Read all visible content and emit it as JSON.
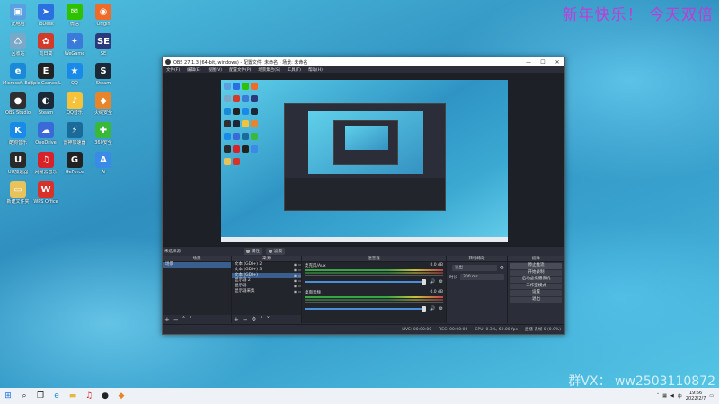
{
  "desktop": {
    "banner": "新年快乐！ 今天双倍",
    "watermark": "群VX：  ww2503110872",
    "icons": [
      {
        "label": "此电脑",
        "color": "#5aa0e0",
        "glyph": "▣"
      },
      {
        "label": "ToDesk",
        "color": "#2b6fe0",
        "glyph": "➤"
      },
      {
        "label": "微信",
        "color": "#2dc100",
        "glyph": "✉"
      },
      {
        "label": "Origin",
        "color": "#f06a28",
        "glyph": "◉"
      },
      {
        "label": "回收站",
        "color": "#7aa8c8",
        "glyph": "♺"
      },
      {
        "label": "向日葵",
        "color": "#d33a2a",
        "glyph": "✿"
      },
      {
        "label": "WeGame",
        "color": "#3a7ad8",
        "glyph": "✦"
      },
      {
        "label": "SE",
        "color": "#2a3a7a",
        "glyph": "SE"
      },
      {
        "label": "Microsoft Edge",
        "color": "#1a8ad8",
        "glyph": "e"
      },
      {
        "label": "Epic Games Launcher",
        "color": "#222222",
        "glyph": "E"
      },
      {
        "label": "QQ",
        "color": "#1a8ae8",
        "glyph": "★"
      },
      {
        "label": "Steam",
        "color": "#1b2838",
        "glyph": "S"
      },
      {
        "label": "OBS Studio",
        "color": "#302e31",
        "glyph": "●"
      },
      {
        "label": "Steam",
        "color": "#1b2838",
        "glyph": "◐"
      },
      {
        "label": "QQ音乐",
        "color": "#f5c23a",
        "glyph": "♪"
      },
      {
        "label": "火绒安全",
        "color": "#e8852a",
        "glyph": "◆"
      },
      {
        "label": "酷狗音乐",
        "color": "#1a8ae8",
        "glyph": "K"
      },
      {
        "label": "OneDrive",
        "color": "#3a6ad8",
        "glyph": "☁"
      },
      {
        "label": "雷神加速器",
        "color": "#1a6a9a",
        "glyph": "⚡"
      },
      {
        "label": "360安全",
        "color": "#3ab83a",
        "glyph": "✚"
      },
      {
        "label": "UU加速器",
        "color": "#2a2a2a",
        "glyph": "U"
      },
      {
        "label": "网易云音乐",
        "color": "#d8222a",
        "glyph": "♫"
      },
      {
        "label": "GeForce",
        "color": "#222222",
        "glyph": "G"
      },
      {
        "label": "Ai",
        "color": "#3a8ae8",
        "glyph": "A"
      },
      {
        "label": "新建文件夹",
        "color": "#e8c25a",
        "glyph": "▭"
      },
      {
        "label": "WPS Office",
        "color": "#d8322a",
        "glyph": "W"
      }
    ]
  },
  "obs": {
    "title": "OBS 27.1.3 (64-bit, windows) - 配置文件: 未命名 - 场景: 未命名",
    "menu": [
      "文件(F)",
      "编辑(E)",
      "视图(V)",
      "配置文件(P)",
      "场景集合(S)",
      "工具(T)",
      "帮助(H)"
    ],
    "scene_bar": {
      "label": "未选择源",
      "btn1": "属性",
      "btn2": "滤镜"
    },
    "scenes": {
      "title": "场景",
      "items": [
        "场景"
      ]
    },
    "sources": {
      "title": "来源",
      "items": [
        "文本 (GDI+) 2",
        "文本 (GDI+) 3",
        "文本 (GDI+)",
        "显示器 2",
        "显示器",
        "显示器采集"
      ]
    },
    "mixer": {
      "title": "混音器",
      "channels": [
        {
          "name": "麦克风/Aux",
          "db": "0.0 dB"
        },
        {
          "name": "桌面音频",
          "db": "0.0 dB"
        }
      ]
    },
    "transitions": {
      "title": "转场特效",
      "type": "淡出",
      "duration_label": "时长",
      "duration": "300 ms"
    },
    "controls": {
      "title": "控件",
      "buttons": [
        "停止推流",
        "开始录制",
        "启动虚拟摄像机",
        "工作室模式",
        "设置",
        "退出"
      ]
    },
    "status": [
      "LIVE: 00:00:00",
      "REC: 00:00:00",
      "CPU: 0.3%, 60.00 fps",
      "直播 丢帧 0 (0.0%)"
    ],
    "window_buttons": [
      "—",
      "☐",
      "✕"
    ]
  },
  "taskbar": {
    "time": "19:56",
    "date": "2022/2/7"
  }
}
